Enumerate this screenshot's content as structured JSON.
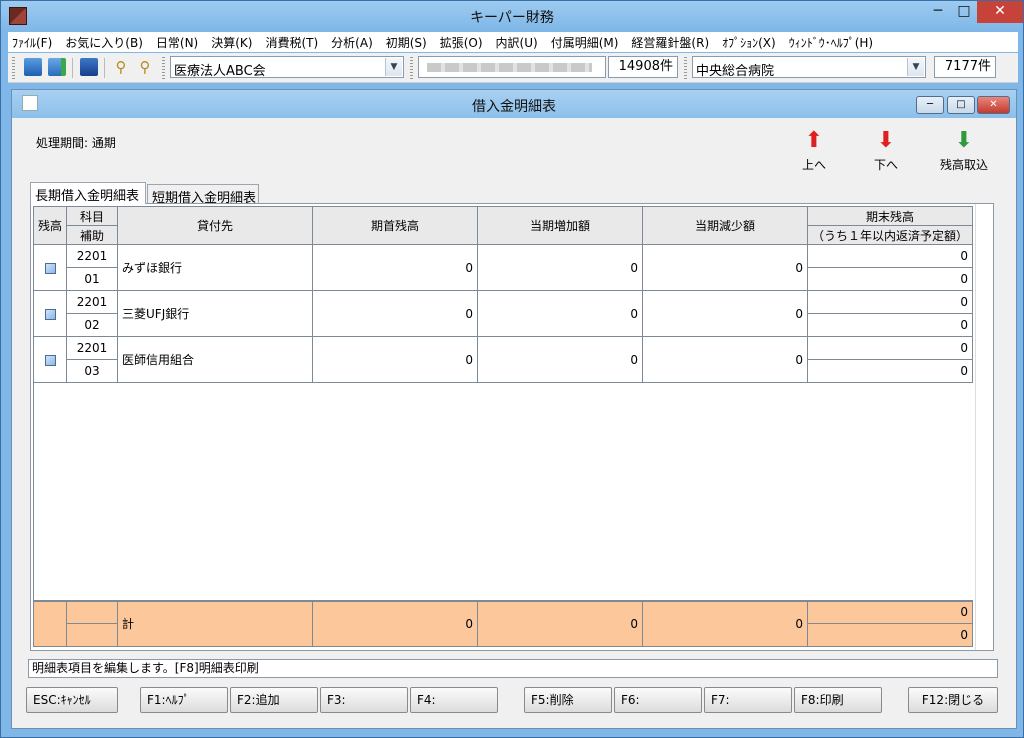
{
  "app": {
    "title": "キーパー財務"
  },
  "menu": [
    "ﾌｧｲﾙ(F)",
    "お気に入り(B)",
    "日常(N)",
    "決算(K)",
    "消費税(T)",
    "分析(A)",
    "初期(S)",
    "拡張(O)",
    "内訳(U)",
    "付属明細(M)",
    "経営羅針盤(R)",
    "ｵﾌﾟｼｮﾝ(X)",
    "ｳｨﾝﾄﾞｳ･ﾍﾙﾌﾟ(H)"
  ],
  "toolbar": {
    "corp_select": "医療法人ABC会",
    "count1": "14908件",
    "facility_select": "中央総合病院",
    "count2": "7177件"
  },
  "window": {
    "title": "借入金明細表",
    "period_label": "処理期間: 通期",
    "actions": {
      "up": "上へ",
      "down": "下へ",
      "import": "残高取込"
    }
  },
  "tabs": [
    "長期借入金明細表",
    "短期借入金明細表"
  ],
  "grid": {
    "headers": {
      "balance": "残高",
      "account": "科目",
      "sub": "補助",
      "lender": "貸付先",
      "opening": "期首残高",
      "increase": "当期増加額",
      "decrease": "当期減少額",
      "closing": "期末残高",
      "closing_note": "（うち１年以内返済予定額）"
    },
    "rows": [
      {
        "account": "2201",
        "sub": "01",
        "lender": "みずほ銀行",
        "opening": "0",
        "increase": "0",
        "decrease": "0",
        "closing": "0",
        "within_year": "0"
      },
      {
        "account": "2201",
        "sub": "02",
        "lender": "三菱UFJ銀行",
        "opening": "0",
        "increase": "0",
        "decrease": "0",
        "closing": "0",
        "within_year": "0"
      },
      {
        "account": "2201",
        "sub": "03",
        "lender": "医師信用組合",
        "opening": "0",
        "increase": "0",
        "decrease": "0",
        "closing": "0",
        "within_year": "0"
      }
    ],
    "total": {
      "label": "計",
      "opening": "0",
      "increase": "0",
      "decrease": "0",
      "closing": "0",
      "within_year": "0"
    }
  },
  "status": "明細表項目を編集します。[F8]明細表印刷",
  "fkeys": [
    "ESC:ｷｬﾝｾﾙ",
    "F1:ﾍﾙﾌﾟ",
    "F2:追加",
    "F3:",
    "F4:",
    "F5:削除",
    "F6:",
    "F7:",
    "F8:印刷",
    "F12:閉じる"
  ],
  "colors": {
    "total_row": "#fcc89b",
    "titlebar": "#8cc0ea",
    "arrow": "#e02020"
  },
  "icons": [
    "app-icon",
    "arrow-up-icon",
    "arrow-down-icon",
    "import-icon",
    "checkbox-icon"
  ]
}
